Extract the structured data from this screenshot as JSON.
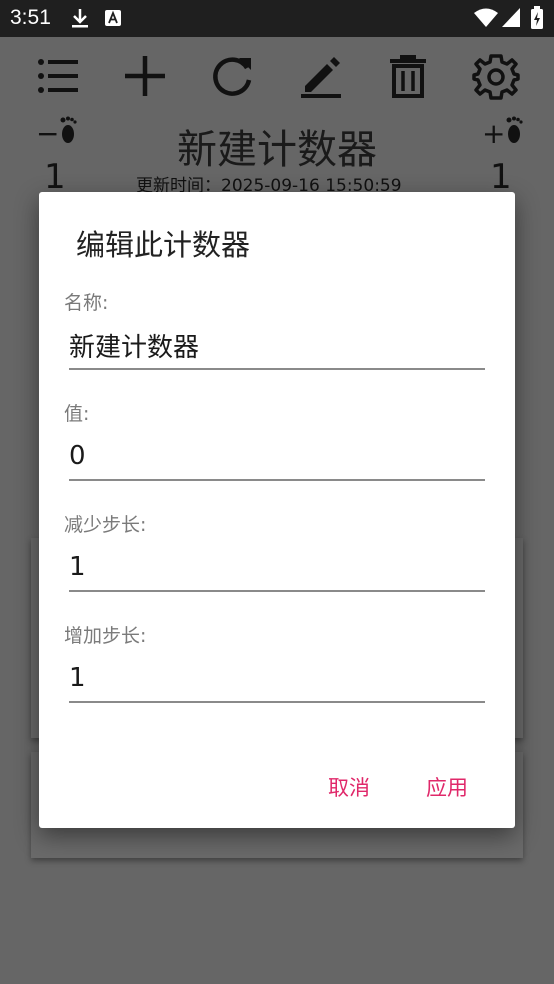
{
  "status_bar": {
    "time": "3:51",
    "icons": [
      "download-icon",
      "a-icon",
      "wifi-icon",
      "signal-icon",
      "battery-icon"
    ]
  },
  "toolbar": {
    "icons": [
      "list-icon",
      "plus-icon",
      "refresh-icon",
      "edit-icon",
      "trash-icon",
      "settings-icon"
    ]
  },
  "counter": {
    "title": "新建计数器",
    "updated": "更新时间：2025-09-16 15:50:59",
    "decrement_label": "−",
    "increment_label": "+",
    "decrement_value": "1",
    "increment_value": "1"
  },
  "dialog": {
    "title": "编辑此计数器",
    "fields": [
      {
        "label": "名称:",
        "value": "新建计数器"
      },
      {
        "label": "值:",
        "value": "0"
      },
      {
        "label": "减少步长:",
        "value": "1"
      },
      {
        "label": "增加步长:",
        "value": "1"
      }
    ],
    "cancel_label": "取消",
    "apply_label": "应用"
  },
  "colors": {
    "accent": "#e0286a",
    "scrim": "#666666",
    "status_bar": "#1f1f1f"
  }
}
